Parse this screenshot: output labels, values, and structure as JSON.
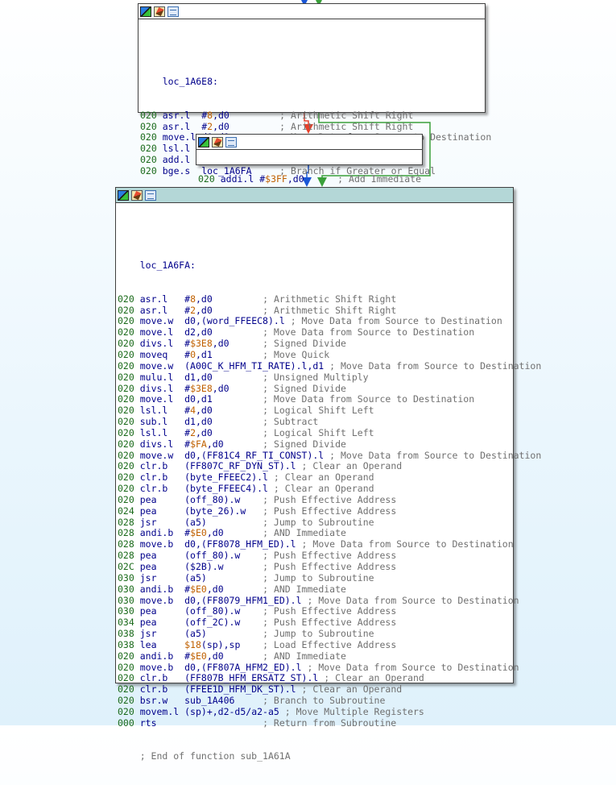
{
  "colors": {
    "edge_true": "#1a56d6",
    "edge_false": "#e8402a",
    "edge_uncond": "#3aa03a",
    "title_active": "#b4d7d7"
  },
  "icons": [
    "graph-icon",
    "edit-icon",
    "xref-icon"
  ],
  "block1": {
    "label": "loc_1A6E8:",
    "lines": [
      {
        "seg": "020",
        "mn": "asr.l",
        "ops": [
          {
            "t": "#",
            "c": "op"
          },
          {
            "t": "8",
            "c": "imm"
          },
          {
            "t": ",d0",
            "c": "op"
          }
        ],
        "cmt": "; Arithmetic Shift Right"
      },
      {
        "seg": "020",
        "mn": "asr.l",
        "ops": [
          {
            "t": "#",
            "c": "op"
          },
          {
            "t": "2",
            "c": "imm"
          },
          {
            "t": ",d0",
            "c": "op"
          }
        ],
        "cmt": "; Arithmetic Shift Right"
      },
      {
        "seg": "020",
        "mn": "move.l",
        "ops": [
          {
            "t": "d0,d1",
            "c": "op"
          }
        ],
        "cmt": "; Move Data from Source to Destination"
      },
      {
        "seg": "020",
        "mn": "lsl.l",
        "ops": [
          {
            "t": "#",
            "c": "op"
          },
          {
            "t": "7",
            "c": "imm"
          },
          {
            "t": ",d0",
            "c": "op"
          }
        ],
        "cmt": "; Logical Shift Left"
      },
      {
        "seg": "020",
        "mn": "add.l",
        "ops": [
          {
            "t": "d1,d0",
            "c": "op"
          }
        ],
        "cmt": "; Add"
      },
      {
        "seg": "020",
        "mn": "bge.s",
        "ops": [
          {
            "t": "loc_1A6FA",
            "c": "op"
          }
        ],
        "cmt": "; Branch if Greater or Equal"
      }
    ]
  },
  "block2": {
    "lines": [
      {
        "seg": "020",
        "mn": "addi.l",
        "ops": [
          {
            "t": "#",
            "c": "op"
          },
          {
            "t": "$3FF",
            "c": "imm"
          },
          {
            "t": ",d0",
            "c": "op"
          }
        ],
        "cmt": "; Add Immediate"
      }
    ]
  },
  "block3": {
    "label": "loc_1A6FA:",
    "lines": [
      {
        "seg": "020",
        "mn": "asr.l",
        "ops": [
          {
            "t": "#",
            "c": "op"
          },
          {
            "t": "8",
            "c": "imm"
          },
          {
            "t": ",d0",
            "c": "op"
          }
        ],
        "cmt": "; Arithmetic Shift Right"
      },
      {
        "seg": "020",
        "mn": "asr.l",
        "ops": [
          {
            "t": "#",
            "c": "op"
          },
          {
            "t": "2",
            "c": "imm"
          },
          {
            "t": ",d0",
            "c": "op"
          }
        ],
        "cmt": "; Arithmetic Shift Right"
      },
      {
        "seg": "020",
        "mn": "move.w",
        "ops": [
          {
            "t": "d0,(word_FFEEC8).l",
            "c": "op"
          }
        ],
        "cmt": "; Move Data from Source to Destination"
      },
      {
        "seg": "020",
        "mn": "move.l",
        "ops": [
          {
            "t": "d2,d0",
            "c": "op"
          }
        ],
        "cmt": "; Move Data from Source to Destination"
      },
      {
        "seg": "020",
        "mn": "divs.l",
        "ops": [
          {
            "t": "#",
            "c": "op"
          },
          {
            "t": "$3E8",
            "c": "imm"
          },
          {
            "t": ",d0",
            "c": "op"
          }
        ],
        "cmt": "; Signed Divide"
      },
      {
        "seg": "020",
        "mn": "moveq",
        "ops": [
          {
            "t": "#",
            "c": "op"
          },
          {
            "t": "0",
            "c": "imm"
          },
          {
            "t": ",d1",
            "c": "op"
          }
        ],
        "cmt": "; Move Quick"
      },
      {
        "seg": "020",
        "mn": "move.w",
        "ops": [
          {
            "t": "(A00C_K_HFM_TI_RATE).l,d1",
            "c": "op"
          }
        ],
        "cmt": "; Move Data from Source to Destination"
      },
      {
        "seg": "020",
        "mn": "mulu.l",
        "ops": [
          {
            "t": "d1,d0",
            "c": "op"
          }
        ],
        "cmt": "; Unsigned Multiply"
      },
      {
        "seg": "020",
        "mn": "divs.l",
        "ops": [
          {
            "t": "#",
            "c": "op"
          },
          {
            "t": "$3E8",
            "c": "imm"
          },
          {
            "t": ",d0",
            "c": "op"
          }
        ],
        "cmt": "; Signed Divide"
      },
      {
        "seg": "020",
        "mn": "move.l",
        "ops": [
          {
            "t": "d0,d1",
            "c": "op"
          }
        ],
        "cmt": "; Move Data from Source to Destination"
      },
      {
        "seg": "020",
        "mn": "lsl.l",
        "ops": [
          {
            "t": "#",
            "c": "op"
          },
          {
            "t": "4",
            "c": "imm"
          },
          {
            "t": ",d0",
            "c": "op"
          }
        ],
        "cmt": "; Logical Shift Left"
      },
      {
        "seg": "020",
        "mn": "sub.l",
        "ops": [
          {
            "t": "d1,d0",
            "c": "op"
          }
        ],
        "cmt": "; Subtract"
      },
      {
        "seg": "020",
        "mn": "lsl.l",
        "ops": [
          {
            "t": "#",
            "c": "op"
          },
          {
            "t": "2",
            "c": "imm"
          },
          {
            "t": ",d0",
            "c": "op"
          }
        ],
        "cmt": "; Logical Shift Left"
      },
      {
        "seg": "020",
        "mn": "divs.l",
        "ops": [
          {
            "t": "#",
            "c": "op"
          },
          {
            "t": "$FA",
            "c": "imm"
          },
          {
            "t": ",d0",
            "c": "op"
          }
        ],
        "cmt": "; Signed Divide"
      },
      {
        "seg": "020",
        "mn": "move.w",
        "ops": [
          {
            "t": "d0,(FF81C4_RF_TI_CONST).l",
            "c": "op"
          }
        ],
        "cmt": "; Move Data from Source to Destination"
      },
      {
        "seg": "020",
        "mn": "clr.b",
        "ops": [
          {
            "t": "(FF807C_RF_DYN_ST).l",
            "c": "op"
          }
        ],
        "cmt": "; Clear an Operand"
      },
      {
        "seg": "020",
        "mn": "clr.b",
        "ops": [
          {
            "t": "(byte_FFEEC2).l",
            "c": "op"
          }
        ],
        "cmt": "; Clear an Operand"
      },
      {
        "seg": "020",
        "mn": "clr.b",
        "ops": [
          {
            "t": "(byte_FFEEC4).l",
            "c": "op"
          }
        ],
        "cmt": "; Clear an Operand"
      },
      {
        "seg": "020",
        "mn": "pea",
        "ops": [
          {
            "t": "(off_80).w",
            "c": "op"
          }
        ],
        "cmt": "; Push Effective Address"
      },
      {
        "seg": "024",
        "mn": "pea",
        "ops": [
          {
            "t": "(byte_26).w",
            "c": "op"
          }
        ],
        "cmt": "; Push Effective Address"
      },
      {
        "seg": "028",
        "mn": "jsr",
        "ops": [
          {
            "t": "(a5)",
            "c": "op"
          }
        ],
        "cmt": "; Jump to Subroutine"
      },
      {
        "seg": "028",
        "mn": "andi.b",
        "ops": [
          {
            "t": "#",
            "c": "op"
          },
          {
            "t": "$E0",
            "c": "imm"
          },
          {
            "t": ",d0",
            "c": "op"
          }
        ],
        "cmt": "; AND Immediate"
      },
      {
        "seg": "028",
        "mn": "move.b",
        "ops": [
          {
            "t": "d0,(FF8078_HFM_ED).l",
            "c": "op"
          }
        ],
        "cmt": "; Move Data from Source to Destination"
      },
      {
        "seg": "028",
        "mn": "pea",
        "ops": [
          {
            "t": "(off_80).w",
            "c": "op"
          }
        ],
        "cmt": "; Push Effective Address"
      },
      {
        "seg": "02C",
        "mn": "pea",
        "ops": [
          {
            "t": "($2B).w",
            "c": "op"
          }
        ],
        "cmt": "; Push Effective Address"
      },
      {
        "seg": "030",
        "mn": "jsr",
        "ops": [
          {
            "t": "(a5)",
            "c": "op"
          }
        ],
        "cmt": "; Jump to Subroutine"
      },
      {
        "seg": "030",
        "mn": "andi.b",
        "ops": [
          {
            "t": "#",
            "c": "op"
          },
          {
            "t": "$E0",
            "c": "imm"
          },
          {
            "t": ",d0",
            "c": "op"
          }
        ],
        "cmt": "; AND Immediate"
      },
      {
        "seg": "030",
        "mn": "move.b",
        "ops": [
          {
            "t": "d0,(FF8079_HFM1_ED).l",
            "c": "op"
          }
        ],
        "cmt": "; Move Data from Source to Destination"
      },
      {
        "seg": "030",
        "mn": "pea",
        "ops": [
          {
            "t": "(off_80).w",
            "c": "op"
          }
        ],
        "cmt": "; Push Effective Address"
      },
      {
        "seg": "034",
        "mn": "pea",
        "ops": [
          {
            "t": "(off_2C).w",
            "c": "op"
          }
        ],
        "cmt": "; Push Effective Address"
      },
      {
        "seg": "038",
        "mn": "jsr",
        "ops": [
          {
            "t": "(a5)",
            "c": "op"
          }
        ],
        "cmt": "; Jump to Subroutine"
      },
      {
        "seg": "038",
        "mn": "lea",
        "ops": [
          {
            "t": "$18",
            "c": "imm"
          },
          {
            "t": "(sp),sp",
            "c": "op"
          }
        ],
        "cmt": "; Load Effective Address"
      },
      {
        "seg": "020",
        "mn": "andi.b",
        "ops": [
          {
            "t": "#",
            "c": "op"
          },
          {
            "t": "$E0",
            "c": "imm"
          },
          {
            "t": ",d0",
            "c": "op"
          }
        ],
        "cmt": "; AND Immediate"
      },
      {
        "seg": "020",
        "mn": "move.b",
        "ops": [
          {
            "t": "d0,(FF807A_HFM2_ED).l",
            "c": "op"
          }
        ],
        "cmt": "; Move Data from Source to Destination"
      },
      {
        "seg": "020",
        "mn": "clr.b",
        "ops": [
          {
            "t": "(FF807B_HFM_ERSATZ_ST).l",
            "c": "op"
          }
        ],
        "cmt": "; Clear an Operand"
      },
      {
        "seg": "020",
        "mn": "clr.b",
        "ops": [
          {
            "t": "(FFEE1D_HFM_DK_ST).l",
            "c": "op"
          }
        ],
        "cmt": "; Clear an Operand"
      },
      {
        "seg": "020",
        "mn": "bsr.w",
        "ops": [
          {
            "t": "sub_1A406",
            "c": "op"
          }
        ],
        "cmt": "; Branch to Subroutine"
      },
      {
        "seg": "020",
        "mn": "movem.l",
        "ops": [
          {
            "t": "(sp)+,d2-d5/a2-a5",
            "c": "op"
          }
        ],
        "cmt": "; Move Multiple Registers"
      },
      {
        "seg": "000",
        "mn": "rts",
        "ops": [],
        "cmt": "; Return from Subroutine"
      }
    ],
    "footer": "; End of function sub_1A61A"
  }
}
